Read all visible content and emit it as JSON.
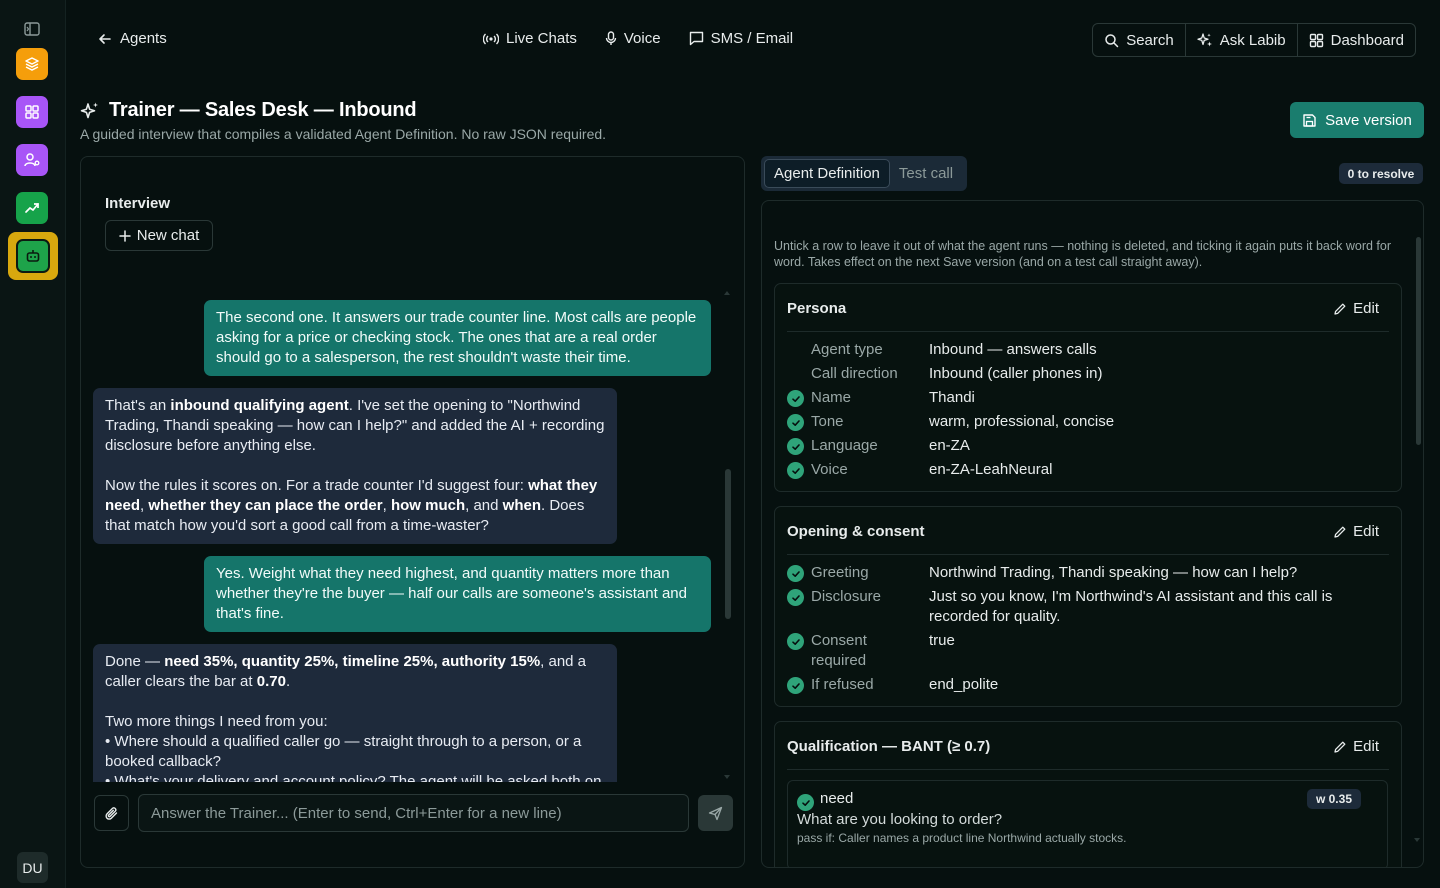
{
  "nav": {
    "back_label": "Agents",
    "center_items": [
      {
        "label": "Live Chats",
        "icon": "broadcast-icon"
      },
      {
        "label": "Voice",
        "icon": "microphone-icon"
      },
      {
        "label": "SMS / Email",
        "icon": "message-icon"
      }
    ],
    "right_items": [
      {
        "label": "Search",
        "icon": "search-icon"
      },
      {
        "label": "Ask Labib",
        "icon": "sparkles-icon"
      },
      {
        "label": "Dashboard",
        "icon": "grid-icon"
      }
    ]
  },
  "rail": {
    "apps": [
      {
        "name": "layers-app",
        "color": "#f59e0b"
      },
      {
        "name": "widgets-app",
        "color": "#a855f7"
      },
      {
        "name": "contacts-app",
        "color": "#a855f7"
      },
      {
        "name": "analytics-app",
        "color": "#16a34a"
      },
      {
        "name": "agents-app",
        "color": "#1ea34a",
        "active": true
      }
    ],
    "avatar_initials": "DU"
  },
  "header": {
    "title": "Trainer — Sales Desk — Inbound",
    "subtitle": "A guided interview that compiles a validated Agent Definition. No raw JSON required.",
    "save_label": "Save version"
  },
  "interview": {
    "title": "Interview",
    "new_chat_label": "New chat",
    "composer_placeholder": "Answer the Trainer... (Enter to send, Ctrl+Enter for a new line)",
    "messages": [
      {
        "role": "user",
        "text": "The second one. It answers our trade counter line. Most calls are people asking for a price or checking stock. The ones that are a real order should go to a salesperson, the rest shouldn't waste their time."
      },
      {
        "role": "bot",
        "p1_a": "That's an ",
        "p1_b": "inbound qualifying agent",
        "p1_c": ". I've set the opening to \"Northwind Trading, Thandi speaking — how can I help?\" and added the AI + recording disclosure before anything else.",
        "p2_a": "Now the rules it scores on. For a trade counter I'd suggest four: ",
        "p2_b": "what they need",
        "p2_c": ", ",
        "p2_d": "whether they can place the order",
        "p2_e": ", ",
        "p2_f": "how much",
        "p2_g": ", and ",
        "p2_h": "when",
        "p2_i": ". Does that match how you'd sort a good call from a time-waster?"
      },
      {
        "role": "user",
        "text": "Yes. Weight what they need highest, and quantity matters more than whether they're the buyer — half our calls are someone's assistant and that's fine."
      },
      {
        "role": "bot",
        "p1_a": "Done — ",
        "p1_b": "need 35%, quantity 25%, timeline 25%, authority 15%",
        "p1_c": ", and a caller clears the bar at ",
        "p1_d": "0.70",
        "p1_e": ".",
        "p2": "Two more things I need from you:",
        "bullet1": "• Where should a qualified caller go — straight through to a person, or a booked callback?",
        "bullet2": "• What's your delivery and account policy? The agent will be asked both on"
      }
    ]
  },
  "right": {
    "tabs": [
      {
        "label": "Agent Definition",
        "active": true
      },
      {
        "label": "Test call",
        "active": false
      }
    ],
    "resolve_badge": "0 to resolve",
    "note": "Untick a row to leave it out of what the agent runs — nothing is deleted, and ticking it again puts it back word for word. Takes effect on the next Save version (and on a test call straight away).",
    "edit_label": "Edit",
    "persona": {
      "title": "Persona",
      "rows": [
        {
          "label": "Agent type",
          "value": "Inbound — answers calls",
          "checked": false
        },
        {
          "label": "Call direction",
          "value": "Inbound (caller phones in)",
          "checked": false
        },
        {
          "label": "Name",
          "value": "Thandi",
          "checked": true
        },
        {
          "label": "Tone",
          "value": "warm, professional, concise",
          "checked": true
        },
        {
          "label": "Language",
          "value": "en-ZA",
          "checked": true
        },
        {
          "label": "Voice",
          "value": "en-ZA-LeahNeural",
          "checked": true
        }
      ]
    },
    "opening": {
      "title": "Opening & consent",
      "rows": [
        {
          "label": "Greeting",
          "value": "Northwind Trading, Thandi speaking — how can I help?",
          "checked": true
        },
        {
          "label": "Disclosure",
          "value": "Just so you know, I'm Northwind's AI assistant and this call is recorded for quality.",
          "checked": true
        },
        {
          "label": "Consent required",
          "value": "true",
          "checked": true
        },
        {
          "label": "If refused",
          "value": "end_polite",
          "checked": true
        }
      ]
    },
    "qualification": {
      "title": "Qualification — BANT (≥ 0.7)",
      "criterion": {
        "name": "need",
        "weight": "w 0.35",
        "question": "What are you looking to order?",
        "pass_if": "pass if: Caller names a product line Northwind actually stocks."
      }
    }
  },
  "colors": {
    "accent": "#1a7d6e",
    "user_bubble": "#15756a",
    "bot_bubble": "#1e2a3b",
    "check": "#2fa47a",
    "active_rail_ring": "#d8a80e"
  }
}
